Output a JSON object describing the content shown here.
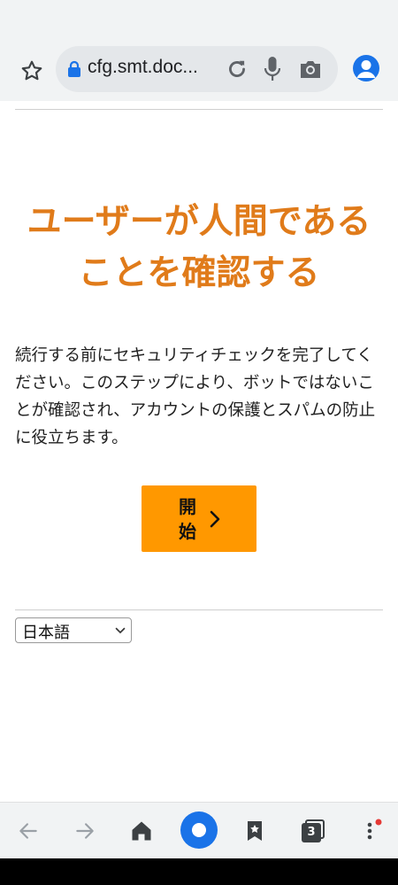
{
  "browser": {
    "url": "cfg.smt.doc...",
    "tab_count": "3",
    "accent_color": "#1a73e8",
    "icons": [
      "star-icon",
      "lock-icon",
      "reload-icon",
      "mic-icon",
      "camera-icon",
      "profile-icon",
      "back-arrow-icon",
      "forward-arrow-icon",
      "home-icon",
      "bookmarks-icon",
      "tabs-icon",
      "menu-icon"
    ]
  },
  "page": {
    "headline_line1": "ユーザーが人間である",
    "headline_line2": "ことを確認する",
    "description": "続行する前にセキュリティチェックを完了してください。このステップにより、ボットではないことが確認され、アカウントの保護とスパムの防止に役立ちます。",
    "start_button_label": "開始",
    "language_selected": "日本語",
    "headline_color": "#e07b1a",
    "button_color": "#ff9800"
  }
}
